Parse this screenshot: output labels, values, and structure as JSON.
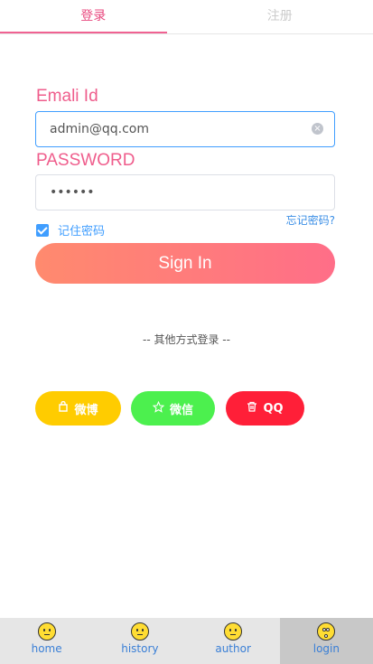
{
  "tabs": [
    {
      "label": "登录",
      "active": true
    },
    {
      "label": "注册",
      "active": false
    }
  ],
  "form": {
    "email_label": "Emali Id",
    "email_value": "admin@qq.com",
    "password_label": "PASSWORD",
    "password_value": "••••••",
    "remember_label": "记住密码",
    "remember_checked": true,
    "forgot_label": "忘记密码?",
    "signin_label": "Sign In"
  },
  "other_login": "-- 其他方式登录 --",
  "social": [
    {
      "label": "微博",
      "icon": "bag-icon",
      "color": "#ffcc00"
    },
    {
      "label": "微信",
      "icon": "star-icon",
      "color": "#4cf04e"
    },
    {
      "label": "QQ",
      "icon": "trash-icon",
      "color": "#ff1f38"
    }
  ],
  "nav": [
    {
      "label": "home",
      "icon": "smiley-icon"
    },
    {
      "label": "history",
      "icon": "smiley-icon"
    },
    {
      "label": "author",
      "icon": "smiley-icon"
    },
    {
      "label": "login",
      "icon": "surprised-face-icon",
      "active": true
    }
  ],
  "colors": {
    "accent": "#ef5d8c",
    "link": "#409eff"
  }
}
